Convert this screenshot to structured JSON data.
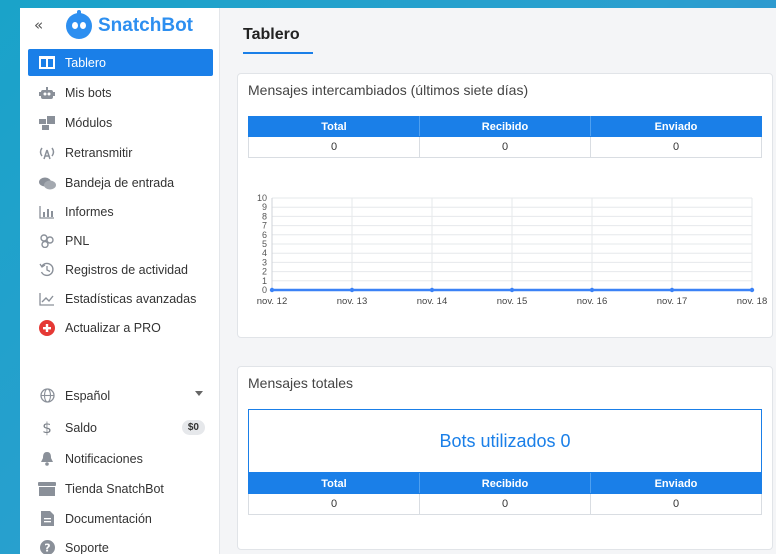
{
  "brand": {
    "name": "SnatchBot",
    "collapse_glyph": "«"
  },
  "sidebar": {
    "items": [
      {
        "label": "Tablero",
        "icon": "dashboard-icon",
        "active": true
      },
      {
        "label": "Mis bots",
        "icon": "robot-icon"
      },
      {
        "label": "Módulos",
        "icon": "modules-icon"
      },
      {
        "label": "Retransmitir",
        "icon": "broadcast-icon"
      },
      {
        "label": "Bandeja de entrada",
        "icon": "inbox-chat-icon"
      },
      {
        "label": "Informes",
        "icon": "reports-icon"
      },
      {
        "label": "PNL",
        "icon": "nlp-icon"
      },
      {
        "label": "Registros de actividad",
        "icon": "history-icon"
      },
      {
        "label": "Estadísticas avanzadas",
        "icon": "analytics-icon"
      },
      {
        "label": "Actualizar a PRO",
        "icon": "upgrade-plus-icon"
      }
    ],
    "bottom": [
      {
        "label": "Español",
        "icon": "globe-icon"
      },
      {
        "label": "Saldo",
        "icon": "dollar-icon",
        "badge": "$0"
      },
      {
        "label": "Notificaciones",
        "icon": "bell-icon"
      },
      {
        "label": "Tienda SnatchBot",
        "icon": "store-icon"
      },
      {
        "label": "Documentación",
        "icon": "document-icon"
      },
      {
        "label": "Soporte",
        "icon": "help-icon"
      }
    ]
  },
  "main": {
    "title": "Tablero",
    "exchanged": {
      "title": "Mensajes intercambiados (últimos siete días)",
      "headers": [
        "Total",
        "Recibido",
        "Enviado"
      ],
      "values": [
        "0",
        "0",
        "0"
      ]
    },
    "totals": {
      "title": "Mensajes totales",
      "bots_used": "Bots utilizados 0",
      "headers": [
        "Total",
        "Recibido",
        "Enviado"
      ],
      "values": [
        "0",
        "0",
        "0"
      ]
    }
  },
  "chart_data": {
    "type": "line",
    "categories": [
      "nov. 12",
      "nov. 13",
      "nov. 14",
      "nov. 15",
      "nov. 16",
      "nov. 17",
      "nov. 18"
    ],
    "series": [
      {
        "values": [
          0,
          0,
          0,
          0,
          0,
          0,
          0
        ],
        "color": "#3b82f6"
      }
    ],
    "yticks": [
      "0",
      "1",
      "2",
      "3",
      "4",
      "5",
      "6",
      "7",
      "8",
      "9",
      "10"
    ],
    "ylim": [
      0,
      10
    ],
    "grid": true
  },
  "colors": {
    "accent": "#1a7fe8",
    "brand": "#2d8ff0",
    "upgrade": "#e53935"
  }
}
